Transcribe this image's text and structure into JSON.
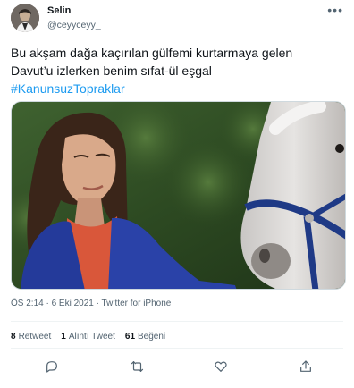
{
  "author": {
    "name": "Selin",
    "handle": "@ceyyceyy_"
  },
  "tweet": {
    "text_line1": "Bu akşam dağa kaçırılan gülfemi kurtarmaya gelen",
    "text_line2": "Davut’u izlerken benim sıfat-ül eşgal",
    "hashtag": "#KanunsuzTopraklar",
    "timestamp": "ÖS 2:14 · 6 Eki 2021 · Twitter for iPhone"
  },
  "stats": {
    "retweets_count": "8",
    "retweets_label": "Retweet",
    "quotes_count": "1",
    "quotes_label": "Alıntı Tweet",
    "likes_count": "61",
    "likes_label": "Beğeni"
  },
  "icons": {
    "more": "more-icon",
    "reply": "reply-icon",
    "retweet": "retweet-icon",
    "like": "heart-icon",
    "share": "share-icon"
  },
  "colors": {
    "text": "#0f1419",
    "secondary": "#536471",
    "link": "#1d9bf0",
    "border": "#eff3f4"
  }
}
